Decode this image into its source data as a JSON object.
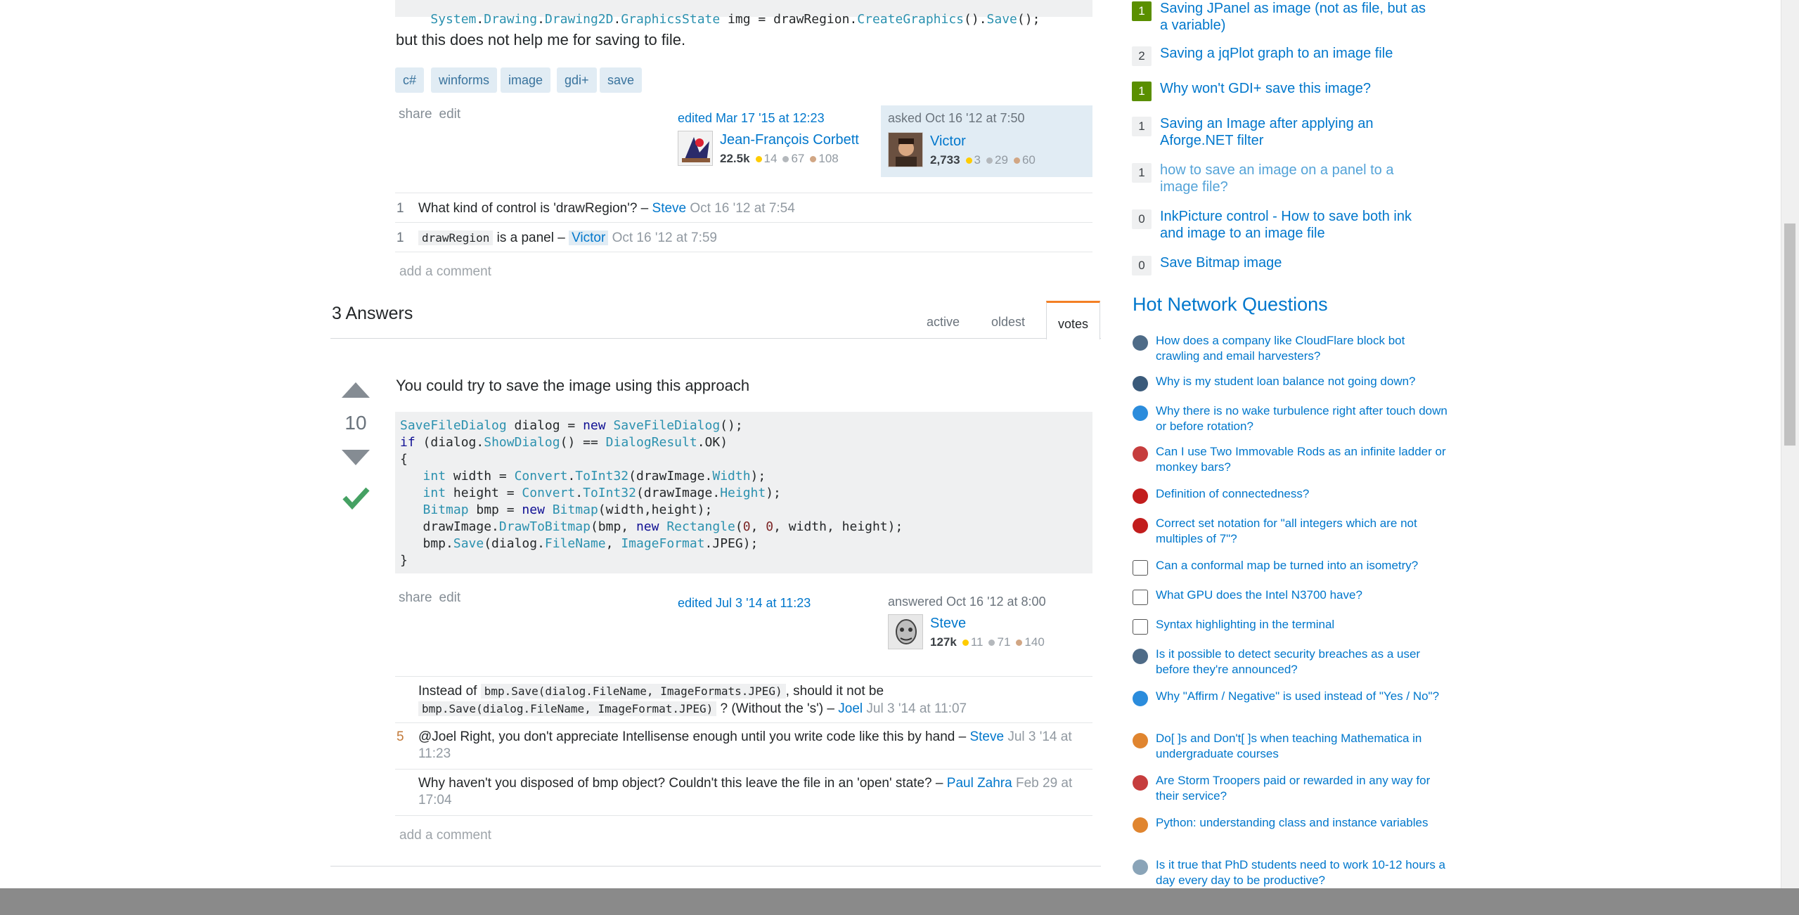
{
  "question": {
    "code_top": "System.Drawing.Drawing2D.GraphicsState img = drawRegion.CreateGraphics().Save();",
    "text_after": "but this does not help me for saving to file.",
    "tags": [
      "c#",
      "winforms",
      "image",
      "gdi+",
      "save"
    ],
    "menu": {
      "share": "share",
      "edit": "edit"
    },
    "edited": {
      "action": "edited Mar 17 '15 at 12:23",
      "user": "Jean-François Corbett",
      "rep": "22.5k",
      "gold": "14",
      "silver": "67",
      "bronze": "108"
    },
    "asked": {
      "action": "asked Oct 16 '12 at 7:50",
      "user": "Victor",
      "rep": "2,733",
      "gold": "3",
      "silver": "29",
      "bronze": "60"
    },
    "comments": [
      {
        "score": "1",
        "text": "What kind of control is 'drawRegion'? – ",
        "user": "Steve",
        "date": "Oct 16 '12 at 7:54"
      },
      {
        "score": "1",
        "code": "drawRegion",
        "text": " is a panel – ",
        "user": "Victor",
        "date": "Oct 16 '12 at 7:59"
      }
    ],
    "add_comment": "add a comment"
  },
  "answers_header": {
    "count": "3 Answers",
    "tabs": [
      "active",
      "oldest",
      "votes"
    ],
    "active_tab": "votes"
  },
  "answer": {
    "votes": "10",
    "intro": "You could try to save the image using this approach",
    "menu": {
      "share": "share",
      "edit": "edit"
    },
    "edited": "edited Jul 3 '14 at 11:23",
    "answered": {
      "action": "answered Oct 16 '12 at 8:00",
      "user": "Steve",
      "rep": "127k",
      "gold": "11",
      "silver": "71",
      "bronze": "140"
    },
    "comments": [
      {
        "score": "",
        "pre": "Instead of ",
        "code1": "bmp.Save(dialog.FileName, ImageFormats.JPEG)",
        "mid": ", should it not be",
        "code2": "bmp.Save(dialog.FileName, ImageFormat.JPEG)",
        "text": " ? (Without the 's') – ",
        "user": "Joel",
        "date": "Jul 3 '14 at 11:07"
      },
      {
        "score": "5",
        "text": "@Joel Right, you don't appreciate Intellisense enough until you write code like this by hand – ",
        "user": "Steve",
        "date": "Jul 3 '14 at 11:23"
      },
      {
        "score": "",
        "text": "Why haven't you disposed of bmp object? Couldn't this leave the file in an 'open' state? – ",
        "user": "Paul Zahra",
        "date": "Feb 29 at 17:04"
      }
    ],
    "add_comment": "add a comment"
  },
  "related": [
    {
      "score": "1",
      "accepted": true,
      "title": "Saving JPanel as image (not as file, but as a variable)"
    },
    {
      "score": "2",
      "accepted": false,
      "title": "Saving a jqPlot graph to an image file"
    },
    {
      "score": "1",
      "accepted": true,
      "title": "Why won't GDI+ save this image?"
    },
    {
      "score": "1",
      "accepted": false,
      "title": "Saving an Image after applying an Aforge.NET filter"
    },
    {
      "score": "1",
      "accepted": false,
      "visited": true,
      "title": "how to save an image on a panel to a image file?"
    },
    {
      "score": "0",
      "accepted": false,
      "title": "InkPicture control - How to save both ink and image to an image file"
    },
    {
      "score": "0",
      "accepted": false,
      "title": "Save Bitmap image"
    }
  ],
  "hot_network": {
    "title": "Hot Network Questions",
    "items": [
      {
        "icon": "security-se-icon",
        "color": "#4e6b87",
        "title": "How does a company like CloudFlare block bot crawling and email harvesters?"
      },
      {
        "icon": "money-se-icon",
        "color": "#3a5a7a",
        "title": "Why is my student loan balance not going down?"
      },
      {
        "icon": "aviation-se-icon",
        "color": "#2b8cdc",
        "title": "Why there is no wake turbulence right after touch down or before rotation?"
      },
      {
        "icon": "puzzling-se-icon",
        "color": "#c63d3d",
        "title": "Can I use Two Immovable Rods as an infinite ladder or monkey bars?"
      },
      {
        "icon": "math-se-icon",
        "color": "#c21d1d",
        "title": "Definition of connectedness?"
      },
      {
        "icon": "math-se-icon",
        "color": "#c21d1d",
        "title": "Correct set notation for \"all integers which are not multiples of 7\"?"
      },
      {
        "icon": "mathoverflow-icon",
        "color": "#ffffff",
        "title": "Can a conformal map be turned into an isometry?"
      },
      {
        "icon": "superuser-icon",
        "color": "#ffffff",
        "title": "What GPU does the Intel N3700 have?"
      },
      {
        "icon": "unix-se-icon",
        "color": "#ffffff",
        "title": "Syntax highlighting in the terminal"
      },
      {
        "icon": "security-se-icon",
        "color": "#4e6b87",
        "title": "Is it possible to detect security breaches as a user before they're announced?"
      },
      {
        "icon": "english-se-icon",
        "color": "#2b8cdc",
        "title": "Why \"Affirm / Negative\" is used instead of \"Yes / No\"?"
      },
      {
        "icon": "mathematica-se-icon",
        "color": "#e0852f",
        "title": "Do[ ]s and Don't[ ]s when teaching Mathematica in undergraduate courses"
      },
      {
        "icon": "scifi-se-icon",
        "color": "#c63d3d",
        "title": "Are Storm Troopers paid or rewarded in any way for their service?"
      },
      {
        "icon": "softwareengineering-icon",
        "color": "#e0852f",
        "title": "Python: understanding class and instance variables"
      },
      {
        "icon": "academia-se-icon",
        "color": "#8aa4b8",
        "title": "Is it true that PhD students need to work 10-12 hours a day every day to be productive?"
      }
    ]
  }
}
